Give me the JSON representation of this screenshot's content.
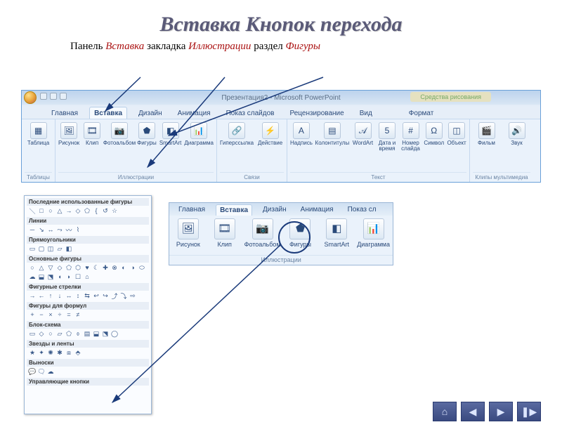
{
  "slide": {
    "title": "Вставка Кнопок перехода",
    "subtitle_parts": {
      "p1": "Панель ",
      "em1": "Вставка",
      "p2": " закладка ",
      "em2": "Иллюстрации",
      "p3": " раздел ",
      "em3": "Фигуры"
    }
  },
  "window": {
    "title": "Презентация2 - Microsoft PowerPoint",
    "context_tab": "Средства рисования"
  },
  "tabs": {
    "home": "Главная",
    "insert": "Вставка",
    "design": "Дизайн",
    "anim": "Анимация",
    "slideshow": "Показ слайдов",
    "review": "Рецензирование",
    "view": "Вид",
    "format": "Формат"
  },
  "groups": {
    "tables": {
      "label": "Таблицы",
      "items": {
        "table": "Таблица"
      }
    },
    "illustrations": {
      "label": "Иллюстрации",
      "items": {
        "picture": "Рисунок",
        "clip": "Клип",
        "album": "Фотоальбом",
        "shapes": "Фигуры",
        "smartart": "SmartArt",
        "chart": "Диаграмма"
      }
    },
    "links": {
      "label": "Связи",
      "items": {
        "hyperlink": "Гиперссылка",
        "action": "Действие"
      }
    },
    "text": {
      "label": "Текст",
      "items": {
        "textbox": "Надпись",
        "headerfooter": "Колонтитулы",
        "wordart": "WordArt",
        "datetime": "Дата и время",
        "slidenum": "Номер слайда",
        "symbol": "Символ",
        "object": "Объект"
      }
    },
    "media": {
      "label": "Клипы мультимедиа",
      "items": {
        "movie": "Фильм",
        "sound": "Звук"
      }
    }
  },
  "shapes_panel": {
    "recent": "Последние использованные фигуры",
    "lines": "Линии",
    "rects": "Прямоугольники",
    "basic": "Основные фигуры",
    "arrows": "Фигурные стрелки",
    "equation": "Фигуры для формул",
    "flowchart": "Блок-схема",
    "stars": "Звезды и ленты",
    "callouts": "Выноски",
    "actionbtns": "Управляющие кнопки"
  },
  "zoom_tabs": {
    "home": "Главная",
    "insert": "Вставка",
    "design": "Дизайн",
    "anim": "Анимация",
    "slideshow": "Показ сл"
  },
  "zoom_group_label": "Иллюстрации",
  "navbuttons": {
    "home": "⌂",
    "back": "◀",
    "fwd": "▶",
    "end": "❚▶"
  }
}
